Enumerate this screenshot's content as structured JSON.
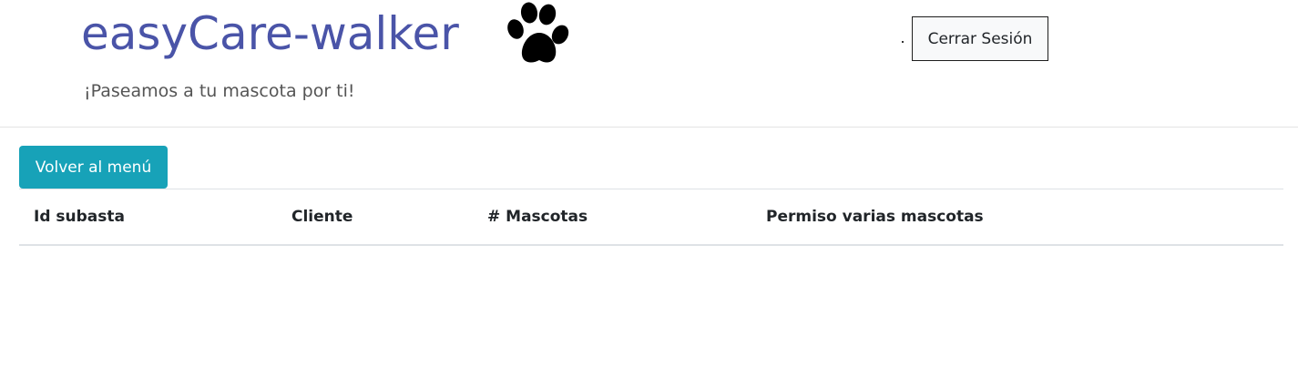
{
  "header": {
    "brand": "easyCare-walker",
    "paw_icon": "paw-icon",
    "tagline": "¡Paseamos a tu mascota por ti!",
    "logout_label": "Cerrar Sesión"
  },
  "main": {
    "back_button_label": "Volver al menú",
    "table": {
      "columns": [
        "Id subasta",
        "Cliente",
        "# Mascotas",
        "Permiso varias mascotas"
      ],
      "rows": []
    }
  },
  "colors": {
    "brand": "#4a54a8",
    "accent_button": "#17a2b8"
  }
}
